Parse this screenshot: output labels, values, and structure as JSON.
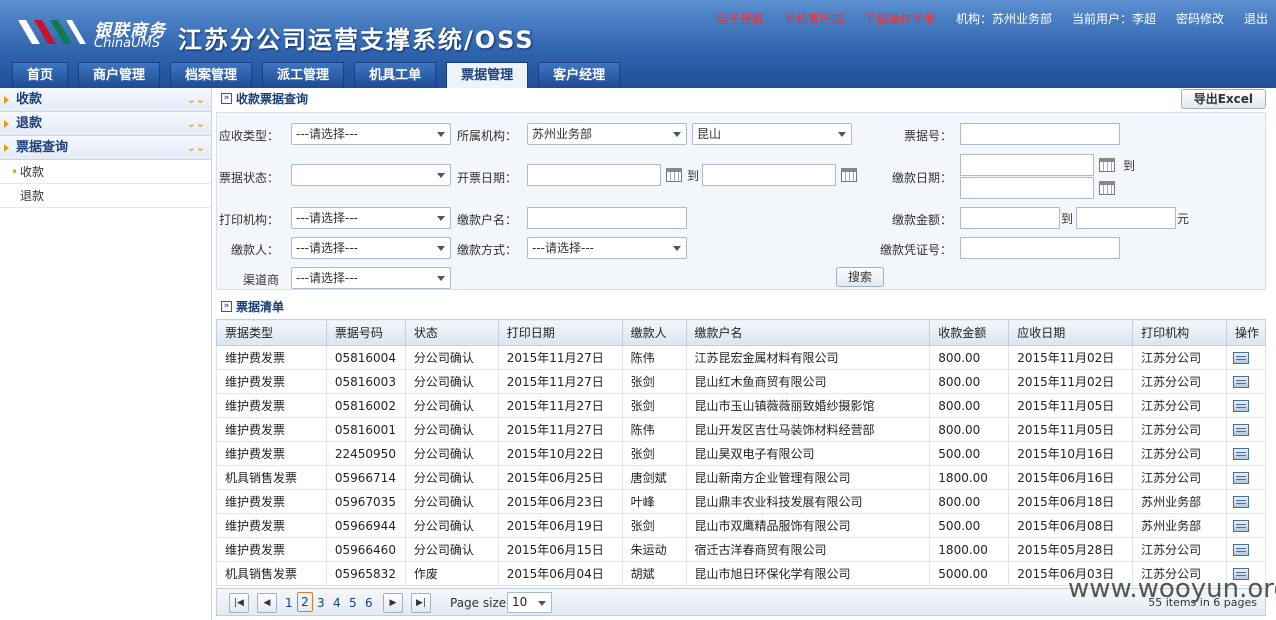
{
  "header": {
    "brand_cn": "银联商务",
    "brand_en": "ChinaUMS",
    "system_title": "江苏分公司运营支撑系统/OSS",
    "links": {
      "esign": "电子签章",
      "mobile_client": "手机客户端",
      "download_manual": "下载操作手册",
      "org": "机构：苏州业务部",
      "current_user": "当前用户：李超",
      "change_password": "密码修改",
      "logout": "退出"
    },
    "colors": {
      "link_red": "#ff2a2a",
      "header_blue": "#2e63ad"
    }
  },
  "nav": {
    "tabs": [
      "首页",
      "商户管理",
      "档案管理",
      "派工管理",
      "机具工单",
      "票据管理",
      "客户经理"
    ],
    "active": "票据管理"
  },
  "sidebar": {
    "groups": [
      "收款",
      "退款",
      "票据查询"
    ],
    "sub_items": [
      "收款",
      "退款"
    ],
    "current": "收款"
  },
  "query": {
    "section_title": "收款票据查询",
    "export_label": "导出Excel",
    "receive_type_label": "应收类型：",
    "receive_type_value": "---请选择---",
    "org_label": "所属机构：",
    "org_value": "苏州业务部",
    "org_sub_value": "昆山",
    "bill_no_label": "票据号：",
    "bill_status_label": "票据状态：",
    "invoice_date_label": "开票日期：",
    "to_label": "到",
    "pay_date_label": "缴款日期：",
    "print_org_label": "打印机构：",
    "print_org_value": "---请选择---",
    "payer_account_label": "缴款户名：",
    "pay_amount_label": "缴款金额：",
    "yuan_label": "元",
    "payer_label": "缴款人：",
    "payer_value": "---请选择---",
    "pay_method_label": "缴款方式：",
    "pay_method_value": "---请选择---",
    "voucher_label": "缴款凭证号：",
    "channel_label": "渠道商",
    "channel_value": "---请选择---",
    "search_label": "搜索"
  },
  "list": {
    "section_title": "票据清单",
    "columns": [
      "票据类型",
      "票据号码",
      "状态",
      "打印日期",
      "缴款人",
      "缴款户名",
      "收款金额",
      "应收日期",
      "打印机构",
      "操作"
    ],
    "rows": [
      [
        "维护费发票",
        "05816004",
        "分公司确认",
        "2015年11月27日",
        "陈伟",
        "江苏昆宏金属材料有限公司",
        "800.00",
        "2015年11月02日",
        "江苏分公司"
      ],
      [
        "维护费发票",
        "05816003",
        "分公司确认",
        "2015年11月27日",
        "张剑",
        "昆山红木鱼商贸有限公司",
        "800.00",
        "2015年11月02日",
        "江苏分公司"
      ],
      [
        "维护费发票",
        "05816002",
        "分公司确认",
        "2015年11月27日",
        "张剑",
        "昆山市玉山镇薇薇丽致婚纱摄影馆",
        "800.00",
        "2015年11月05日",
        "江苏分公司"
      ],
      [
        "维护费发票",
        "05816001",
        "分公司确认",
        "2015年11月27日",
        "陈伟",
        "昆山开发区吉仕马装饰材料经营部",
        "800.00",
        "2015年11月05日",
        "江苏分公司"
      ],
      [
        "维护费发票",
        "22450950",
        "分公司确认",
        "2015年10月22日",
        "张剑",
        "昆山昊双电子有限公司",
        "500.00",
        "2015年10月16日",
        "江苏分公司"
      ],
      [
        "机具销售发票",
        "05966714",
        "分公司确认",
        "2015年06月25日",
        "唐剑斌",
        "昆山新南方企业管理有限公司",
        "1800.00",
        "2015年06月16日",
        "江苏分公司"
      ],
      [
        "维护费发票",
        "05967035",
        "分公司确认",
        "2015年06月23日",
        "叶峰",
        "昆山鼎丰农业科技发展有限公司",
        "800.00",
        "2015年06月18日",
        "苏州业务部"
      ],
      [
        "维护费发票",
        "05966944",
        "分公司确认",
        "2015年06月19日",
        "张剑",
        "昆山市双鹰精品服饰有限公司",
        "500.00",
        "2015年06月08日",
        "苏州业务部"
      ],
      [
        "维护费发票",
        "05966460",
        "分公司确认",
        "2015年06月15日",
        "朱运动",
        "宿迁古洋春商贸有限公司",
        "1800.00",
        "2015年05月28日",
        "江苏分公司"
      ],
      [
        "机具销售发票",
        "05965832",
        "作废",
        "2015年06月04日",
        "胡斌",
        "昆山市旭日环保化学有限公司",
        "5000.00",
        "2015年06月03日",
        "江苏分公司"
      ]
    ]
  },
  "pager": {
    "pages": [
      "1",
      "2",
      "3",
      "4",
      "5",
      "6"
    ],
    "current_page": "2",
    "page_size_label": "Page size:",
    "page_size_value": "10",
    "info": "55 items in 6 pages"
  },
  "watermark": "www.wooyun.org"
}
